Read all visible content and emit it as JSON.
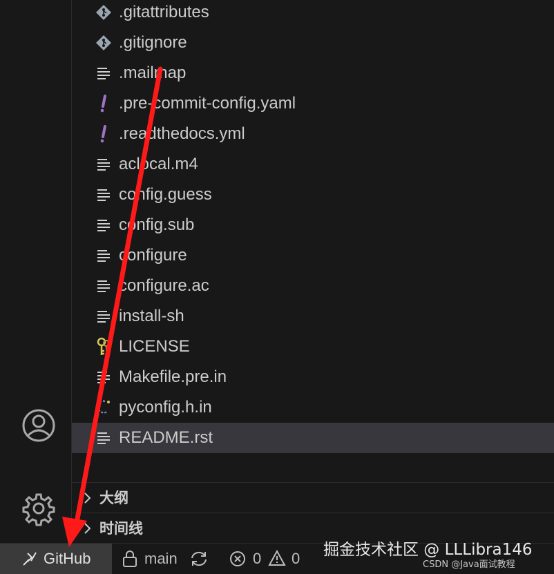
{
  "explorer": {
    "files": [
      {
        "name": ".gitattributes",
        "icon": "git-icon"
      },
      {
        "name": ".gitignore",
        "icon": "git-icon"
      },
      {
        "name": ".mailmap",
        "icon": "text-file-icon"
      },
      {
        "name": ".pre-commit-config.yaml",
        "icon": "yaml-icon"
      },
      {
        "name": ".readthedocs.yml",
        "icon": "yaml-icon"
      },
      {
        "name": "aclocal.m4",
        "icon": "text-file-icon"
      },
      {
        "name": "config.guess",
        "icon": "text-file-icon"
      },
      {
        "name": "config.sub",
        "icon": "text-file-icon"
      },
      {
        "name": "configure",
        "icon": "text-file-icon"
      },
      {
        "name": "configure.ac",
        "icon": "text-file-icon"
      },
      {
        "name": "install-sh",
        "icon": "text-file-icon"
      },
      {
        "name": "LICENSE",
        "icon": "license-icon"
      },
      {
        "name": "Makefile.pre.in",
        "icon": "text-file-icon"
      },
      {
        "name": "pyconfig.h.in",
        "icon": "c-header-icon"
      },
      {
        "name": "README.rst",
        "icon": "text-file-icon",
        "selected": true
      }
    ],
    "sections": [
      {
        "title": "大纲"
      },
      {
        "title": "时间线"
      }
    ]
  },
  "activity_bar": {
    "account_icon": "account-icon",
    "settings_icon": "gear-icon"
  },
  "status_bar": {
    "remote_label": "GitHub",
    "branch": "main",
    "errors": "0",
    "warnings": "0"
  },
  "watermark": {
    "line1": "掘金技术社区 @ LLLibra146",
    "line2": "CSDN @Java面试教程"
  },
  "colors": {
    "background": "#181818",
    "selected_row": "#37373d",
    "yaml_icon": "#a074c4",
    "annotation_arrow": "#ff1a1a"
  }
}
